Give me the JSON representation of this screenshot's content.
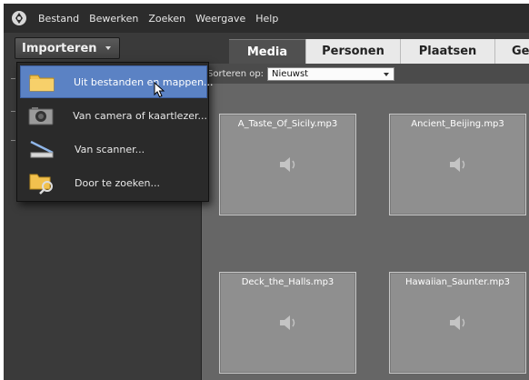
{
  "menubar": {
    "items": [
      "Bestand",
      "Bewerken",
      "Zoeken",
      "Weergave",
      "Help"
    ]
  },
  "toolbar": {
    "import_label": "Importeren",
    "tabs": [
      "Media",
      "Personen",
      "Plaatsen",
      "Geb"
    ]
  },
  "dropdown": {
    "items": [
      {
        "label": "Uit bestanden en mappen...",
        "icon": "folder-icon",
        "active": true
      },
      {
        "label": "Van camera of kaartlezer...",
        "icon": "camera-icon",
        "active": false
      },
      {
        "label": "Van scanner...",
        "icon": "scanner-icon",
        "active": false
      },
      {
        "label": "Door te zoeken...",
        "icon": "folder-search-icon",
        "active": false
      }
    ]
  },
  "sort": {
    "label": "Sorteren op:",
    "value": "Nieuwst"
  },
  "media": {
    "items": [
      {
        "name": "A_Taste_Of_Sicily.mp3",
        "icon": "speaker-icon"
      },
      {
        "name": "Ancient_Beijing.mp3",
        "icon": "speaker-icon"
      },
      {
        "name": "Deck_the_Halls.mp3",
        "icon": "speaker-icon"
      },
      {
        "name": "Hawaiian_Saunter.mp3",
        "icon": "speaker-icon"
      }
    ]
  },
  "colors": {
    "highlight": "#5b82c4",
    "menubar": "#2c2c2c",
    "content_bg": "#666666"
  }
}
